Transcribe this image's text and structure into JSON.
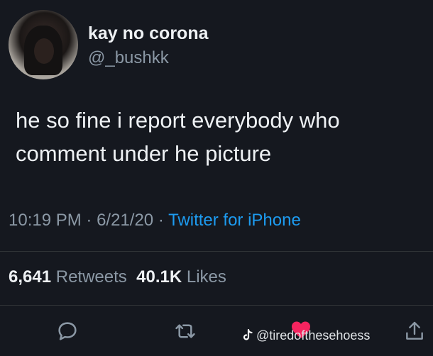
{
  "user": {
    "display_name": "kay no corona",
    "handle": "@_bushkk"
  },
  "tweet": {
    "text": "he so fine i report everybody who\ncomment under he  picture"
  },
  "meta": {
    "time": "10:19 PM",
    "date": "6/21/20",
    "separator": "·",
    "source": "Twitter for iPhone"
  },
  "stats": {
    "retweets_count": "6,641",
    "retweets_label": "Retweets",
    "likes_count": "40.1K",
    "likes_label": "Likes"
  },
  "actions": {
    "reply_icon": "reply-icon",
    "retweet_icon": "retweet-icon",
    "like_icon": "heart-icon",
    "share_icon": "share-icon"
  },
  "watermark": {
    "text": "@tiredofthesehoess"
  },
  "colors": {
    "background": "#15181f",
    "link": "#1d9bf0",
    "muted": "#8b98a5",
    "heart": "#f5245f"
  }
}
